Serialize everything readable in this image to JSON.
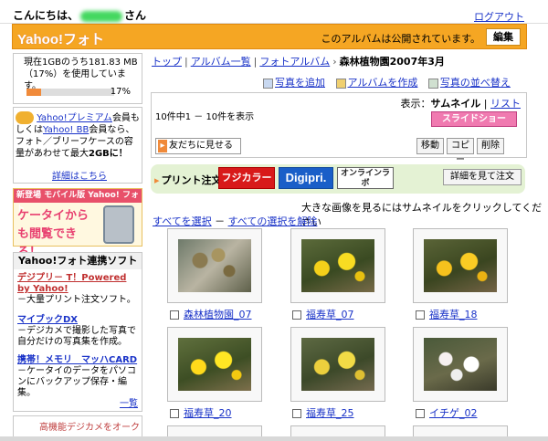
{
  "header": {
    "greeting_prefix": "こんにちは、",
    "greeting_suffix": "さん",
    "logout": "ログアウト"
  },
  "brand": {
    "name": "Yahoo!フォト",
    "public_msg": "このアルバムは公開されています。",
    "edit": "編集"
  },
  "storage": {
    "line1": "現在1GBのうち181.83 MB",
    "line2": "（17%）を使用しています。",
    "percent_label": "17%",
    "percent": 17
  },
  "premium": {
    "text1": "Yahoo!プレミアム",
    "text2": "会員もしくは",
    "text3": "Yahoo! BB",
    "text4": "会員なら、フォト／ブリーフケースの容量があわせて最大",
    "text5": "2GB",
    "text6": "に！",
    "more": "詳細はこちら"
  },
  "mobile_banner": {
    "header": "新登場 モバイル版 Yahoo! フォト",
    "big": "ケータイからも閲覧できる！"
  },
  "soft": {
    "header": "Yahoo!フォト連携ソフト",
    "items": [
      {
        "title": "デジプリ－ T！Powered by Yahoo!",
        "desc": "－大量プリント注文ソフト。"
      },
      {
        "title": "マイブックDX",
        "desc": "－デジカメで撮影した写真で自分だけの写真集を作成。"
      },
      {
        "title": "携帯！メモリ　マッハCARD",
        "desc": "－ケータイのデータをパソコンにバックアップ保存・編集。"
      }
    ],
    "list": "一覧"
  },
  "camera_banner": "高機能デジカメをオーク",
  "breadcrumb": {
    "top": "トップ",
    "albums": "アルバム一覧",
    "photo_album": "フォトアルバム",
    "current": "森林植物園2007年3月"
  },
  "actions": {
    "add_photo": "写真を追加",
    "create_album": "アルバムを作成",
    "sort": "写真の並べ替え"
  },
  "album": {
    "count": "10件中1 － 10件を表示",
    "view_label": "表示：",
    "view_thumb": "サムネイル",
    "view_list": "リスト",
    "slideshow": "スライドショー",
    "share": "友だちに見せる",
    "move": "移動",
    "copy": "コピー",
    "delete": "削除"
  },
  "print": {
    "label": "プリント注文",
    "fuji": "フジカラー",
    "digi": "Digipri.",
    "online": "オンラインラボ",
    "detail": "詳細を見て注文"
  },
  "hint": "大きな画像を見るにはサムネイルをクリックしてください",
  "select_all": "すべてを選択",
  "deselect_all": "すべての選択を解除",
  "photos": [
    {
      "caption": "森林植物園_07",
      "kind": "bud"
    },
    {
      "caption": "福寿草_07",
      "kind": "yellow"
    },
    {
      "caption": "福寿草_18",
      "kind": "yellow"
    },
    {
      "caption": "福寿草_20",
      "kind": "yellow"
    },
    {
      "caption": "福寿草_25",
      "kind": "yellow"
    },
    {
      "caption": "イチゲ_02",
      "kind": "white"
    }
  ]
}
